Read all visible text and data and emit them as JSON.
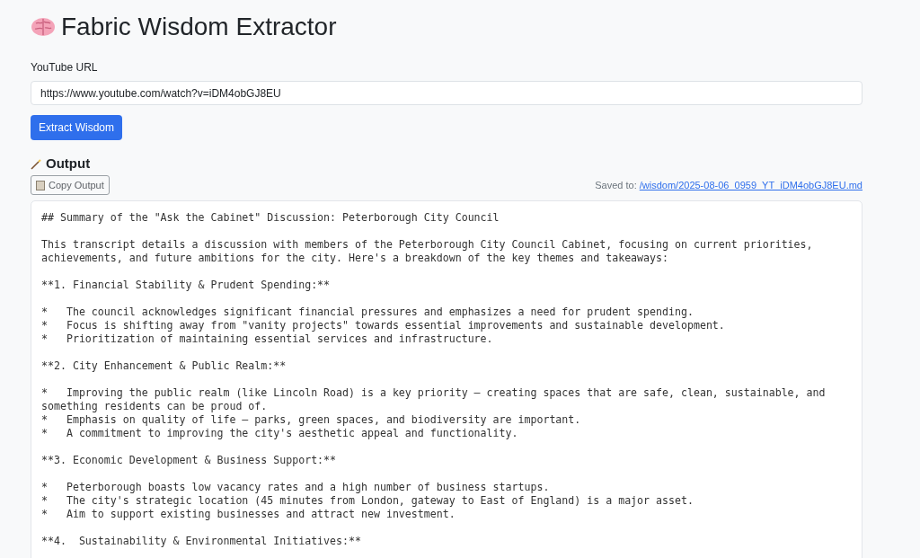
{
  "title": "Fabric Wisdom Extractor",
  "url_field": {
    "label": "YouTube URL",
    "value": "https://www.youtube.com/watch?v=iDM4obGJ8EU"
  },
  "extract_button": "Extract Wisdom",
  "output": {
    "heading": "Output",
    "copy_button": "Copy Output",
    "saved_label": "Saved to:",
    "saved_link": "/wisdom/2025-08-06_0959_YT_iDM4obGJ8EU.md",
    "blocks": [
      [
        "## Summary of the \"Ask the Cabinet\" Discussion: Peterborough City Council"
      ],
      [
        "This transcript details a discussion with members of the Peterborough City Council Cabinet, focusing on current priorities, achievements, and future ambitions for the city. Here's a breakdown of the key themes and takeaways:"
      ],
      [
        "**1. Financial Stability & Prudent Spending:**"
      ],
      [
        "*   The council acknowledges significant financial pressures and emphasizes a need for prudent spending.",
        "*   Focus is shifting away from \"vanity projects\" towards essential improvements and sustainable development.",
        "*   Prioritization of maintaining essential services and infrastructure."
      ],
      [
        "**2. City Enhancement & Public Realm:**"
      ],
      [
        "*   Improving the public realm (like Lincoln Road) is a key priority – creating spaces that are safe, clean, sustainable, and something residents can be proud of.",
        "*   Emphasis on quality of life – parks, green spaces, and biodiversity are important.",
        "*   A commitment to improving the city's aesthetic appeal and functionality."
      ],
      [
        "**3. Economic Development & Business Support:**"
      ],
      [
        "*   Peterborough boasts low vacancy rates and a high number of business startups.",
        "*   The city's strategic location (45 minutes from London, gateway to East of England) is a major asset.",
        "*   Aim to support existing businesses and attract new investment."
      ],
      [
        "**4.  Sustainability & Environmental Initiatives:**"
      ]
    ]
  }
}
